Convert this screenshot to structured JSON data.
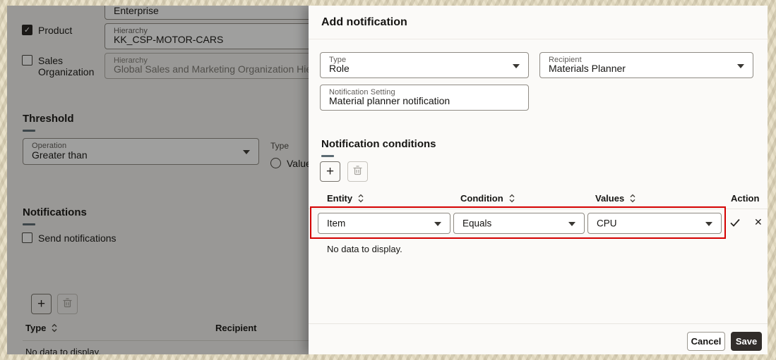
{
  "main_page": {
    "top_field": {
      "value": "Enterprise"
    },
    "filters": [
      {
        "label": "Product",
        "checked": true,
        "field_label": "Hierarchy",
        "field_value": "KK_CSP-MOTOR-CARS"
      },
      {
        "label": "Sales Organization",
        "checked": false,
        "field_label": "Hierarchy",
        "field_value": "Global Sales and Marketing Organization Hierarchy"
      }
    ],
    "threshold": {
      "title": "Threshold",
      "operation_label": "Operation",
      "operation_value": "Greater than",
      "type_label": "Type",
      "radio_value_label": "Value",
      "radio_selected": false
    },
    "notifications": {
      "title": "Notifications",
      "send_checkbox_label": "Send notifications",
      "send_checked": false,
      "columns": [
        "Type",
        "Recipient"
      ],
      "empty_text": "No data to display."
    }
  },
  "drawer": {
    "title": "Add notification",
    "fields": {
      "type": {
        "label": "Type",
        "value": "Role"
      },
      "recipient": {
        "label": "Recipient",
        "value": "Materials Planner"
      },
      "setting": {
        "label": "Notification Setting",
        "value": "Material planner notification"
      }
    },
    "conditions": {
      "title": "Notification conditions",
      "columns": [
        "Entity",
        "Condition",
        "Values",
        "Action"
      ],
      "row": {
        "entity": "Item",
        "condition": "Equals",
        "values": "CPU"
      },
      "empty_text": "No data to display."
    },
    "footer": {
      "cancel_label": "Cancel",
      "save_label": "Save"
    }
  },
  "icons": {
    "plus": "+",
    "close": "✕",
    "check_mark": "✓"
  },
  "colors": {
    "accent_underline": "#5c6b73",
    "highlight_red": "#d40000",
    "save_button_bg": "#312d2a",
    "scrim": "rgba(15,14,13,0.40)",
    "frame_beige": "#e9e1ca"
  }
}
